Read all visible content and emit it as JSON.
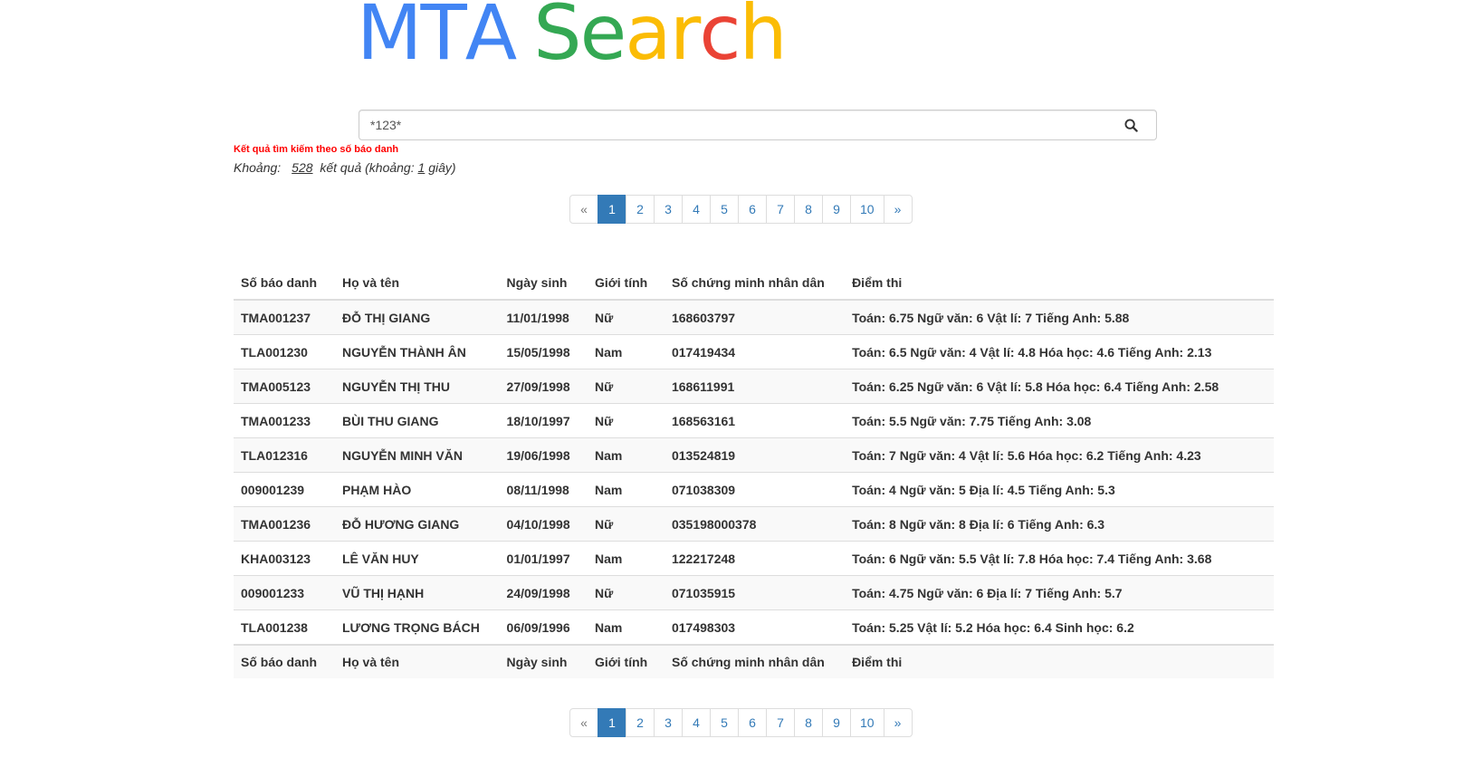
{
  "logo": {
    "letters": [
      {
        "char": "M",
        "color": "#4285f4"
      },
      {
        "char": "T",
        "color": "#4285f4"
      },
      {
        "char": "A",
        "color": "#4285f4"
      },
      {
        "char": " ",
        "color": "#4285f4"
      },
      {
        "char": "S",
        "color": "#34a853"
      },
      {
        "char": "e",
        "color": "#34a853"
      },
      {
        "char": "a",
        "color": "#fbbc05"
      },
      {
        "char": "r",
        "color": "#fbbc05"
      },
      {
        "char": "c",
        "color": "#ea4335"
      },
      {
        "char": "h",
        "color": "#fbbc05"
      }
    ]
  },
  "search": {
    "value": "*123*",
    "button_icon": "search-icon"
  },
  "result_info": {
    "type_label": "Kết quả tìm kiếm theo số báo danh",
    "prefix": "Khoảng:",
    "count": "528",
    "middle": "kết quả (khoảng:",
    "seconds": "1",
    "suffix": "giây)"
  },
  "pagination": {
    "prev": "«",
    "next": "»",
    "pages": [
      "1",
      "2",
      "3",
      "4",
      "5",
      "6",
      "7",
      "8",
      "9",
      "10"
    ],
    "active": "1"
  },
  "table": {
    "headers": [
      "Số báo danh",
      "Họ và tên",
      "Ngày sinh",
      "Giới tính",
      "Số chứng minh nhân dân",
      "Điểm thi"
    ],
    "rows": [
      [
        "TMA001237",
        "ĐỖ THỊ GIANG",
        "11/01/1998",
        "Nữ",
        "168603797",
        "Toán: 6.75 Ngữ văn: 6 Vật lí: 7 Tiếng Anh: 5.88"
      ],
      [
        "TLA001230",
        "NGUYỄN THÀNH ÂN",
        "15/05/1998",
        "Nam",
        "017419434",
        "Toán: 6.5 Ngữ văn: 4 Vật lí: 4.8 Hóa học: 4.6 Tiếng Anh: 2.13"
      ],
      [
        "TMA005123",
        "NGUYỄN THỊ THU",
        "27/09/1998",
        "Nữ",
        "168611991",
        "Toán: 6.25 Ngữ văn: 6 Vật lí: 5.8 Hóa học: 6.4 Tiếng Anh: 2.58"
      ],
      [
        "TMA001233",
        "BÙI THU GIANG",
        "18/10/1997",
        "Nữ",
        "168563161",
        "Toán: 5.5 Ngữ văn: 7.75 Tiếng Anh: 3.08"
      ],
      [
        "TLA012316",
        "NGUYỄN MINH VĂN",
        "19/06/1998",
        "Nam",
        "013524819",
        "Toán: 7 Ngữ văn: 4 Vật lí: 5.6 Hóa học: 6.2 Tiếng Anh: 4.23"
      ],
      [
        "009001239",
        "PHẠM HÀO",
        "08/11/1998",
        "Nam",
        "071038309",
        "Toán: 4 Ngữ văn: 5 Địa lí: 4.5 Tiếng Anh: 5.3"
      ],
      [
        "TMA001236",
        "ĐỖ HƯƠNG GIANG",
        "04/10/1998",
        "Nữ",
        "035198000378",
        "Toán: 8 Ngữ văn: 8 Địa lí: 6 Tiếng Anh: 6.3"
      ],
      [
        "KHA003123",
        "LÊ VĂN HUY",
        "01/01/1997",
        "Nam",
        "122217248",
        "Toán: 6 Ngữ văn: 5.5 Vật lí: 7.8 Hóa học: 7.4 Tiếng Anh: 3.68"
      ],
      [
        "009001233",
        "VŨ THỊ HẠNH",
        "24/09/1998",
        "Nữ",
        "071035915",
        "Toán: 4.75 Ngữ văn: 6 Địa lí: 7 Tiếng Anh: 5.7"
      ],
      [
        "TLA001238",
        "LƯƠNG TRỌNG BÁCH",
        "06/09/1996",
        "Nam",
        "017498303",
        "Toán: 5.25 Vật lí: 5.2 Hóa học: 6.4 Sinh học: 6.2"
      ]
    ]
  },
  "colors": {
    "accent": "#337ab7",
    "error_text": "#ff0000"
  }
}
